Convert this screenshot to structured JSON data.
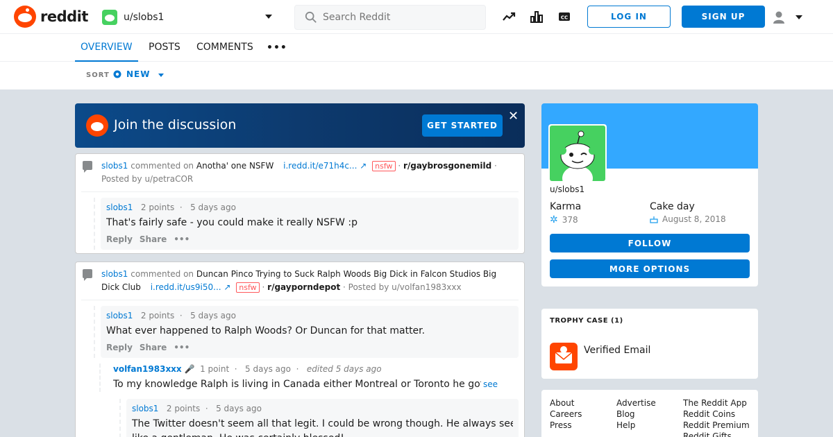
{
  "header": {
    "logo_text": "reddit",
    "current_user": "u/slobs1",
    "search_placeholder": "Search Reddit",
    "login_label": "LOG IN",
    "signup_label": "SIGN UP"
  },
  "tabs": [
    {
      "label": "OVERVIEW",
      "active": true
    },
    {
      "label": "POSTS",
      "active": false
    },
    {
      "label": "COMMENTS",
      "active": false
    }
  ],
  "tabs_more": "•••",
  "sort": {
    "label": "SORT",
    "value": "NEW"
  },
  "banner": {
    "text": "Join the discussion",
    "button": "GET STARTED",
    "close": "✕"
  },
  "cards": [
    {
      "user": "slobs1",
      "commented_on": "commented on",
      "post_title": "Anotha' one NSFW",
      "url": "i.redd.it/e71h4c...",
      "nsfw": "nsfw",
      "subreddit": "r/gaybrosgonemild",
      "posted_by": "· Posted by u/petraCOR",
      "comments": [
        {
          "user": "slobs1",
          "points": "2 points",
          "age": "5 days ago",
          "body": "That's fairly safe - you could make it really NSFW :p",
          "reply": "Reply",
          "share": "Share"
        }
      ]
    },
    {
      "user": "slobs1",
      "commented_on": "commented on",
      "post_title": "Duncan Pinco Trying to Suck Ralph Woods Big Dick in Falcon Studios Big Dick Club",
      "url": "i.redd.it/us9i50...",
      "nsfw": "nsfw",
      "subreddit": "r/gayporndepot",
      "posted_by": "· Posted by u/volfan1983xxx",
      "comments": [
        {
          "user": "slobs1",
          "points": "2 points",
          "age": "5 days ago",
          "body": "What ever happened to Ralph Woods? Or Duncan for that matter.",
          "reply": "Reply",
          "share": "Share"
        },
        {
          "user": "volfan1983xxx",
          "points": "1 point",
          "age": "5 days ago",
          "edited": "edited 5 days ago",
          "body": "To my knowledge Ralph is living in Canada either Montreal or Toronto he got married",
          "see_more": "see more"
        },
        {
          "user": "slobs1",
          "points": "2 points",
          "age": "5 days ago",
          "body1": "The Twitter doesn't seem all that legit. I could be wrong though. He always seemed",
          "body2": "like a gentleman. He was certainly blessed!"
        }
      ]
    }
  ],
  "profile": {
    "username": "u/slobs1",
    "karma_label": "Karma",
    "karma_value": "378",
    "cakeday_label": "Cake day",
    "cakeday_value": "August 8, 2018",
    "follow_label": "FOLLOW",
    "more_label": "MORE OPTIONS"
  },
  "trophy": {
    "title": "TROPHY CASE (1)",
    "name": "Verified Email"
  },
  "footer": {
    "col1": [
      "About",
      "Careers",
      "Press"
    ],
    "col2": [
      "Advertise",
      "Blog",
      "Help"
    ],
    "col3": [
      "The Reddit App",
      "Reddit Coins",
      "Reddit Premium",
      "Reddit Gifts"
    ]
  },
  "colors": {
    "accent": "#0079d3",
    "brand": "#ff4500",
    "background": "#dae0e6"
  }
}
